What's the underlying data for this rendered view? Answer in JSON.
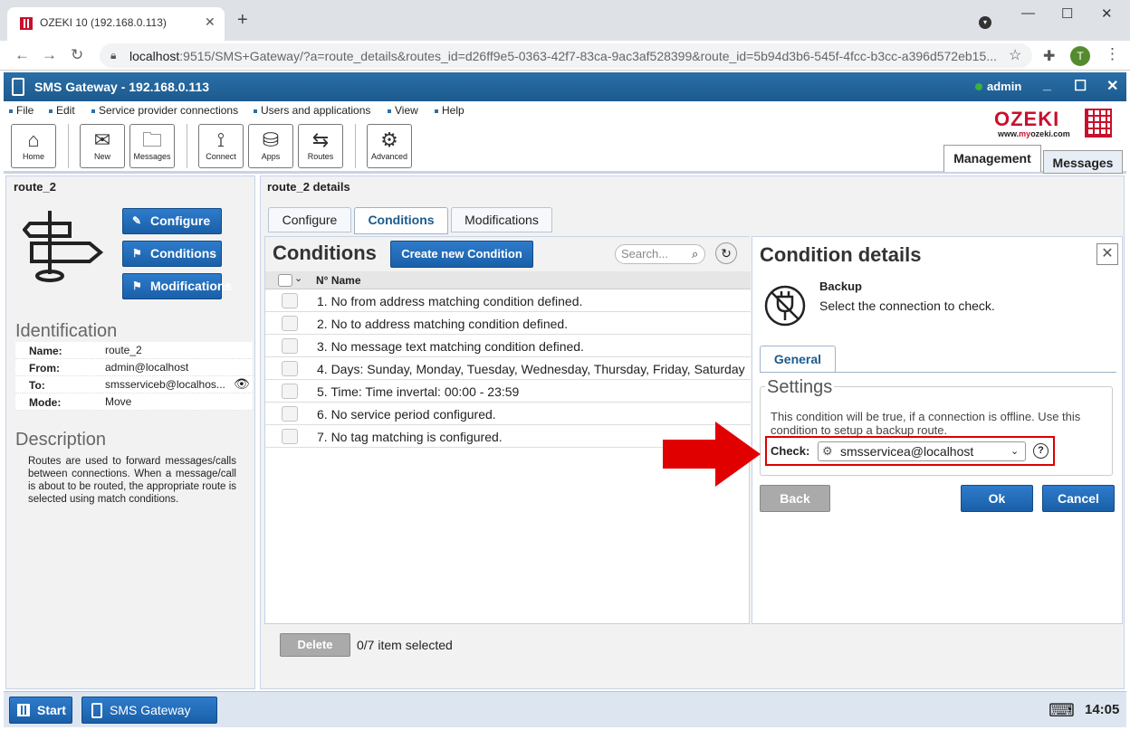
{
  "browser": {
    "tab_title": "OZEKI 10 (192.168.0.113)",
    "url_host": "localhost",
    "url_rest": ":9515/SMS+Gateway/?a=route_details&routes_id=d26ff9e5-0363-42f7-83ca-9ac3af528399&route_id=5b94d3b6-545f-4fcc-b3cc-a396d572eb15...",
    "avatar_letter": "T",
    "icons": [
      "lock-icon",
      "star-icon",
      "extensions-icon",
      "menu-icon"
    ]
  },
  "app": {
    "title": "SMS Gateway - 192.168.0.113",
    "user": "admin"
  },
  "menu": [
    "File",
    "Edit",
    "Service provider connections",
    "Users and applications",
    "View",
    "Help"
  ],
  "toolbar": {
    "home": "Home",
    "new": "New",
    "messages": "Messages",
    "connect": "Connect",
    "apps": "Apps",
    "routes": "Routes",
    "advanced": "Advanced"
  },
  "logo": {
    "brand": "OZEKI",
    "url_pre": "www.",
    "url_my": "my",
    "url_post": "ozeki.com"
  },
  "top_tabs": {
    "management": "Management",
    "messages": "Messages"
  },
  "left": {
    "title": "route_2",
    "buttons": {
      "configure": "Configure",
      "conditions": "Conditions",
      "modifications": "Modifications"
    },
    "identification_heading": "Identification",
    "identification": [
      {
        "key": "Name:",
        "value": "route_2"
      },
      {
        "key": "From:",
        "value": "admin@localhost"
      },
      {
        "key": "To:",
        "value": "smsserviceb@localhos..."
      },
      {
        "key": "Mode:",
        "value": "Move"
      }
    ],
    "description_heading": "Description",
    "description": "Routes are used to forward messages/calls between connections. When a message/call is about to be routed, the appropriate route is selected using match conditions."
  },
  "main": {
    "title": "route_2 details",
    "tabs": [
      "Configure",
      "Conditions",
      "Modifications"
    ],
    "conditions": {
      "heading": "Conditions",
      "create_button": "Create new Condition",
      "search_placeholder": "Search...",
      "col_no": "N°",
      "col_name": "Name",
      "rows": [
        "1. No from address matching condition defined.",
        "2. No to address matching condition defined.",
        "3. No message text matching condition defined.",
        "4. Days: Sunday, Monday, Tuesday, Wednesday, Thursday, Friday, Saturday",
        "5. Time: Time invertal: 00:00 - 23:59",
        "6. No service period configured.",
        "7. No tag matching is configured."
      ],
      "delete_button": "Delete",
      "selected": "0/7 item selected"
    },
    "details": {
      "heading": "Condition details",
      "name": "Backup",
      "desc": "Select the connection to check.",
      "tab": "General",
      "settings_title": "Settings",
      "settings_desc": "This condition will be true, if a connection is offline. Use this condition to setup a backup route.",
      "check_label": "Check:",
      "check_value": "smsservicea@localhost",
      "help": "?",
      "back": "Back",
      "ok": "Ok",
      "cancel": "Cancel"
    }
  },
  "taskbar": {
    "start": "Start",
    "app": "SMS Gateway",
    "clock": "14:05"
  },
  "colors": {
    "accent": "#1a5fa8",
    "brand": "#c8102e",
    "highlight": "#dd0000"
  }
}
